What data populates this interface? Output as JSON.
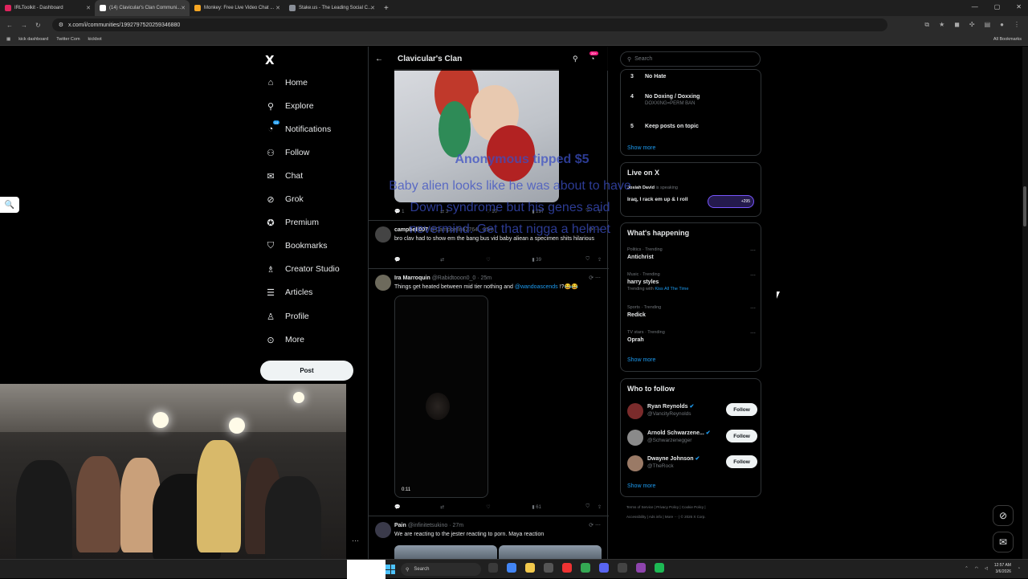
{
  "browser": {
    "tabs": [
      {
        "label": "IRLToolkit - Dashboard",
        "color": "#e0245e"
      },
      {
        "label": "(14) Clavicular's Clan Communi...",
        "color": "#ffffff"
      },
      {
        "label": "Monkey: Free Live Video Chat ...",
        "color": "#f5a623"
      },
      {
        "label": "Stake.us - The Leading Social C...",
        "color": "#8a8f98"
      }
    ],
    "url": "x.com/i/communities/1992797520259346880",
    "bookmarks": [
      "kick dashboard",
      "Twitter Com",
      "kickbot"
    ],
    "all_bookmarks": "All Bookmarks"
  },
  "nav": {
    "logo": "X",
    "items": [
      {
        "label": "Home",
        "icon": "home-icon",
        "glyph": "⌂"
      },
      {
        "label": "Explore",
        "icon": "search-icon",
        "glyph": "⚲"
      },
      {
        "label": "Notifications",
        "icon": "bell-icon",
        "glyph": "🔔",
        "badge": "14"
      },
      {
        "label": "Follow",
        "icon": "add-person-icon",
        "glyph": "♙"
      },
      {
        "label": "Chat",
        "icon": "mail-icon",
        "glyph": "✉"
      },
      {
        "label": "Grok",
        "icon": "grok-icon",
        "glyph": "⊘"
      },
      {
        "label": "Premium",
        "icon": "premium-icon",
        "glyph": "✪"
      },
      {
        "label": "Bookmarks",
        "icon": "bookmark-icon",
        "glyph": "⛉"
      },
      {
        "label": "Creator Studio",
        "icon": "creator-icon",
        "glyph": "♗"
      },
      {
        "label": "Articles",
        "icon": "articles-icon",
        "glyph": "☰"
      },
      {
        "label": "Profile",
        "icon": "profile-icon",
        "glyph": "♙"
      },
      {
        "label": "More",
        "icon": "more-icon",
        "glyph": "⋯"
      }
    ],
    "post_label": "Post"
  },
  "feed": {
    "title": "Clavicular's Clan",
    "notif_badge": "20+",
    "overlay_tip": "Anonymous tipped $5",
    "overlay_msg": "Baby alien looks like he was about to have Down syndrome but his genes said nevermind. Get that nigga a helmet",
    "post1_actions": {
      "replies": "1",
      "reposts": "3",
      "likes": "10",
      "views": "297"
    },
    "tweets": [
      {
        "name": "campbell007",
        "handle": "@Campbelln62764 · 25m",
        "text": "bro clav had to show em the bang bus vid baby aliean a specimen shits hilarious",
        "views": "39"
      },
      {
        "name": "Ira Marroquin",
        "handle": "@Rabidtooon0_0 · 25m",
        "text": "Things get heated between mid tier nothing and",
        "mention": "@wandoascends",
        "text_end": " !?😂😂",
        "duration": "0:11",
        "views": "61"
      },
      {
        "name": "Pain",
        "handle": "@infinitetsukino · 27m",
        "text": "We are reacting to the jester reacting to porn. Maya reaction"
      }
    ]
  },
  "right": {
    "search_placeholder": "Search",
    "rules": [
      {
        "num": "3",
        "title": "No Hate"
      },
      {
        "num": "4",
        "title": "No Doxing / Doxxing",
        "sub": "DOXXING=PERM BAN"
      },
      {
        "num": "5",
        "title": "Keep posts on topic"
      }
    ],
    "rules_show_more": "Show more",
    "live": {
      "title": "Live on X",
      "speaker": "Josiah David",
      "speaking": " is speaking",
      "space": "Iraq, I rack em up & I roll",
      "count": "+295"
    },
    "happening": {
      "title": "What's happening",
      "trends": [
        {
          "meta": "Politics · Trending",
          "name": "Antichrist"
        },
        {
          "meta": "Music · Trending",
          "name": "harry styles",
          "with_label": "Trending with ",
          "with": "Kiss All The Time"
        },
        {
          "meta": "Sports · Trending",
          "name": "Redick"
        },
        {
          "meta": "TV stars · Trending",
          "name": "Oprah"
        }
      ],
      "show_more": "Show more"
    },
    "who_to_follow": {
      "title": "Who to follow",
      "accounts": [
        {
          "name": "Ryan Reynolds",
          "handle": "@VancityReynolds"
        },
        {
          "name": "Arnold Schwarzene...",
          "handle": "@Schwarzenegger"
        },
        {
          "name": "Dwayne Johnson",
          "handle": "@TheRock"
        }
      ],
      "follow_label": "Follow",
      "show_more": "Show more"
    },
    "footer": {
      "line1": "Terms of Service  |  Privacy Policy  |  Cookie Policy  |",
      "line2": "Accessibility  |  Ads info  |  More ···  |  © 2026 X Corp."
    }
  },
  "taskbar": {
    "search_placeholder": "Search",
    "time": "12:57 AM",
    "date": "3/6/2026"
  }
}
